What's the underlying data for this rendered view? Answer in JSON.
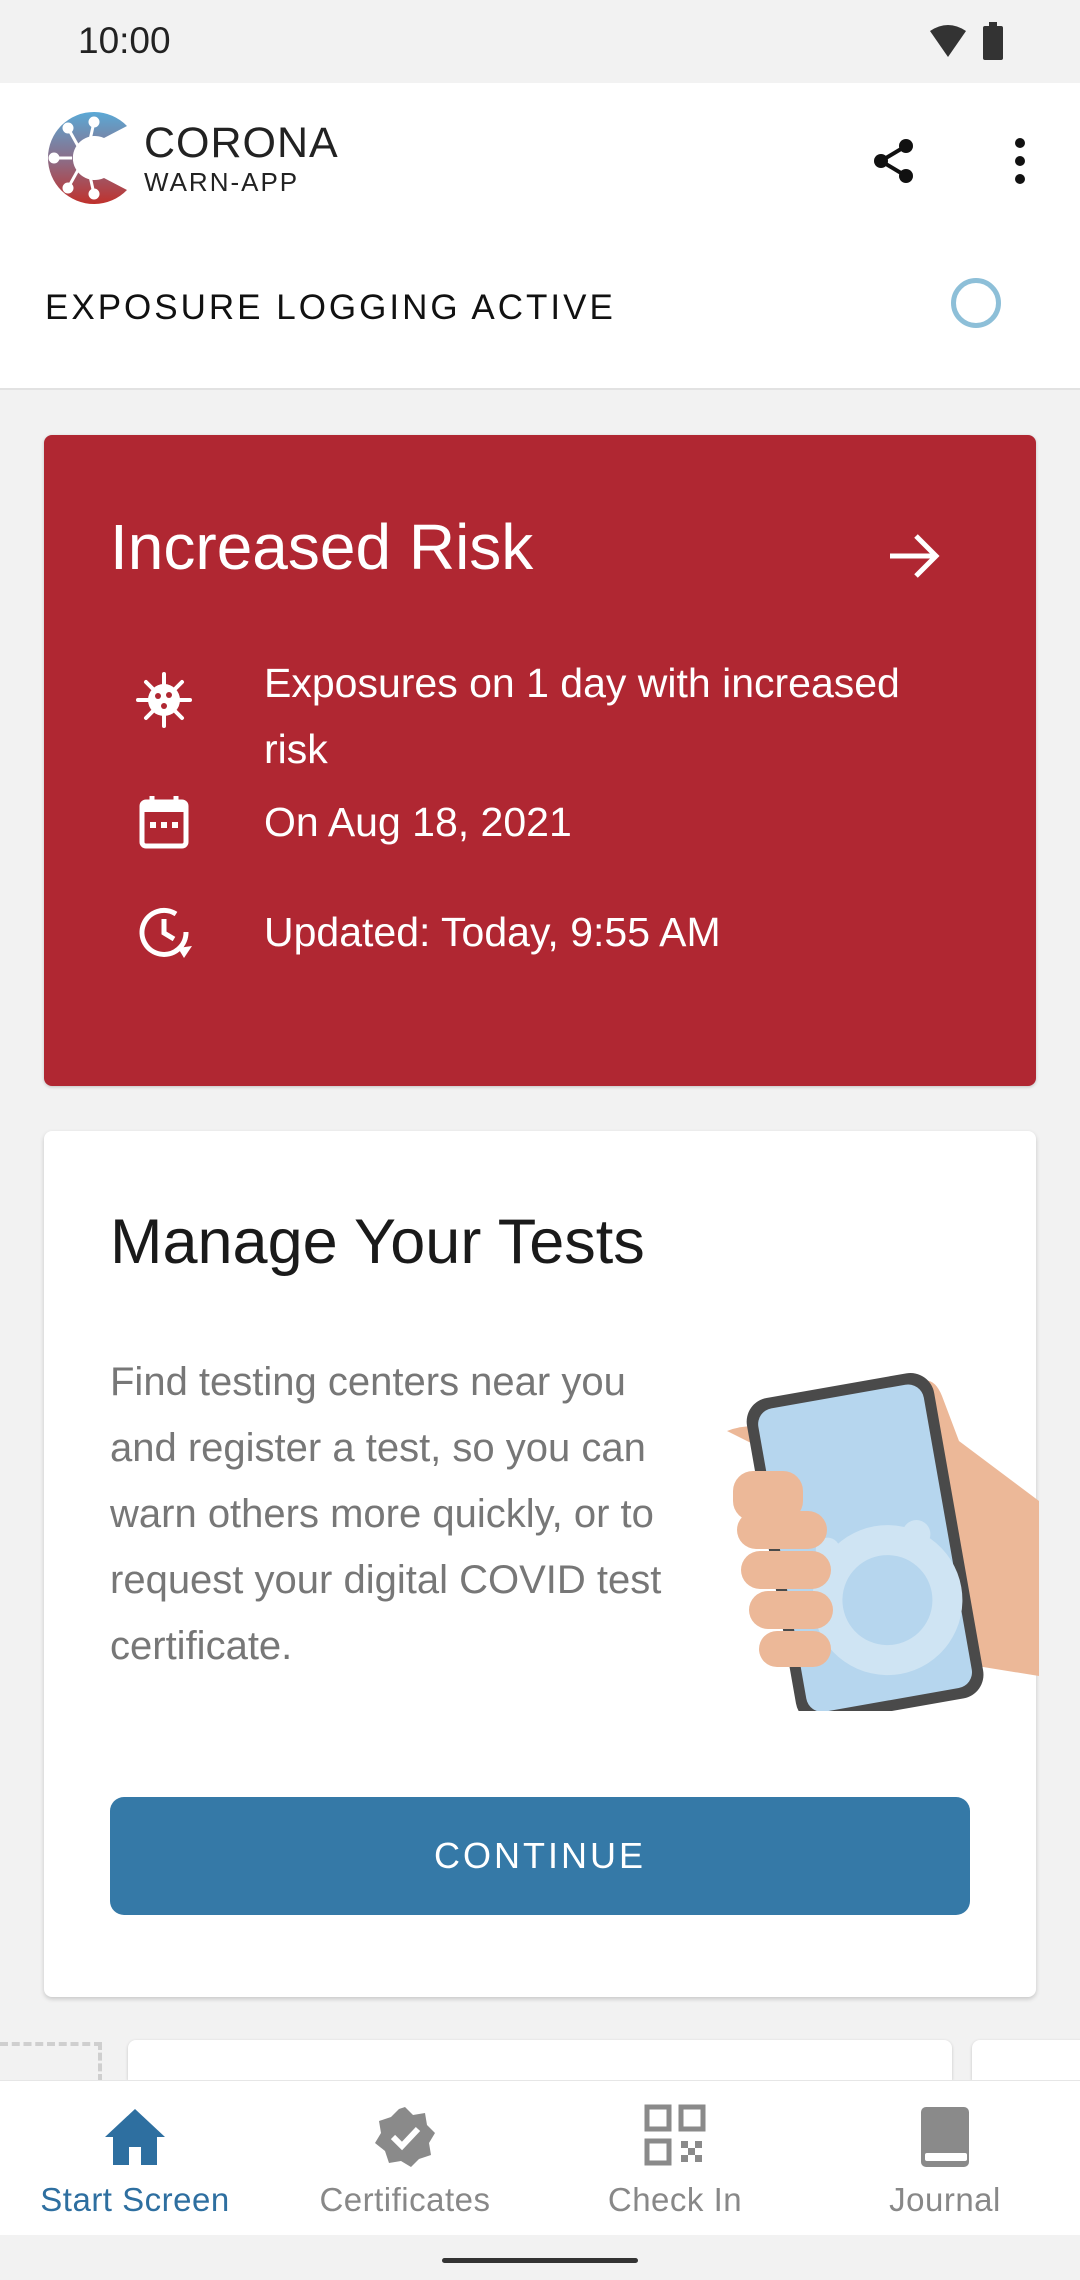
{
  "status_bar": {
    "time": "10:00"
  },
  "header": {
    "logo_line1": "CORONA",
    "logo_line2": "WARN-APP",
    "exposure_logging_label": "EXPOSURE LOGGING ACTIVE"
  },
  "risk_card": {
    "title": "Increased Risk",
    "rows": [
      {
        "icon": "virus-icon",
        "text": "Exposures on 1 day with increased risk"
      },
      {
        "icon": "calendar-icon",
        "text": "On Aug 18, 2021"
      },
      {
        "icon": "clock-update-icon",
        "text": "Updated: Today, 9:55 AM"
      }
    ],
    "background_color": "#b02732"
  },
  "tests_card": {
    "title": "Manage Your Tests",
    "body": "Find testing centers near you and register a test, so you can warn others more quickly, or to request your digital COVID test certificate.",
    "button_label": "CONTINUE",
    "button_color": "#3579a7"
  },
  "bottom_nav": {
    "items": [
      {
        "label": "Start Screen",
        "icon": "home-icon",
        "active": true
      },
      {
        "label": "Certificates",
        "icon": "certificate-badge-icon",
        "active": false
      },
      {
        "label": "Check In",
        "icon": "qr-code-icon",
        "active": false
      },
      {
        "label": "Journal",
        "icon": "journal-book-icon",
        "active": false
      }
    ],
    "active_color": "#2e6fa0"
  }
}
